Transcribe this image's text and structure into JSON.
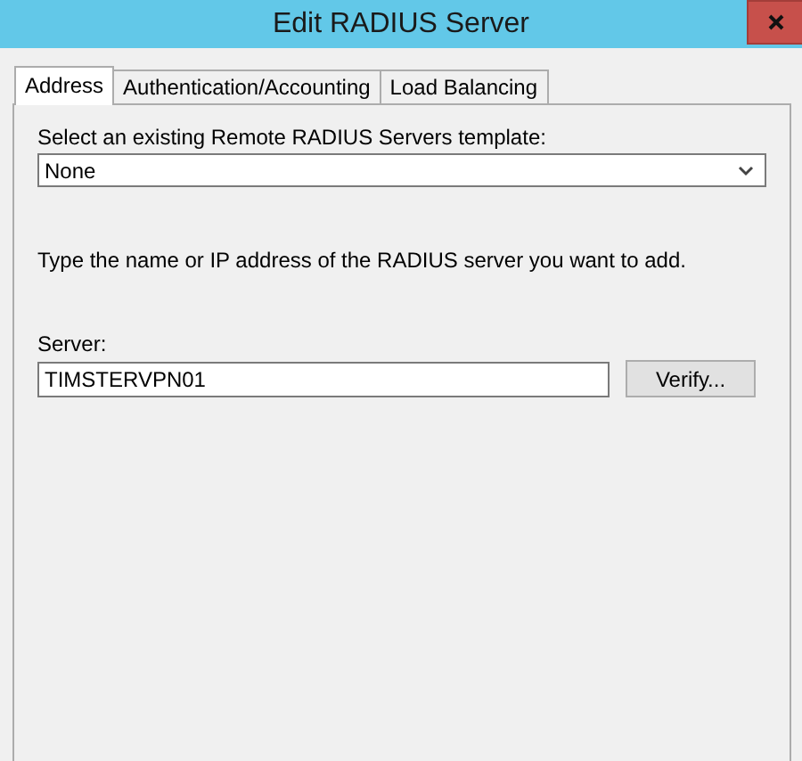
{
  "window": {
    "title": "Edit RADIUS Server"
  },
  "tabs": [
    {
      "label": "Address",
      "selected": true
    },
    {
      "label": "Authentication/Accounting",
      "selected": false
    },
    {
      "label": "Load Balancing",
      "selected": false
    }
  ],
  "template": {
    "label": "Select an existing Remote RADIUS Servers template:",
    "value": "None"
  },
  "instruction": "Type the name or IP address of the RADIUS server you want to add.",
  "server": {
    "label": "Server:",
    "value": "TIMSTERVPN01"
  },
  "buttons": [
    "Verify..."
  ]
}
